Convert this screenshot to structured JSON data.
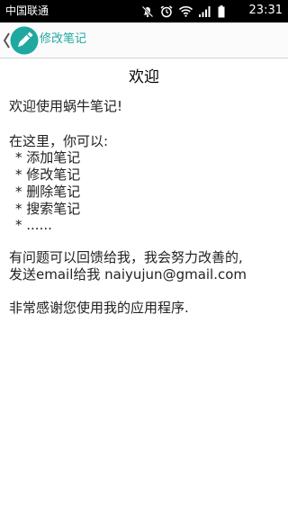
{
  "status_bar": {
    "carrier": "中国联通",
    "time": "23:31"
  },
  "action_bar": {
    "title": "修改笔记",
    "accent_color": "#1fa8a0"
  },
  "note": {
    "title": "欢迎",
    "greeting": "欢迎使用蜗牛笔记!",
    "intro": "在这里，你可以:",
    "features": [
      "* 添加笔记",
      "* 修改笔记",
      "* 删除笔记",
      "* 搜索笔记",
      "* ......"
    ],
    "feedback_line1": "有问题可以回馈给我，我会努力改善的,",
    "feedback_line2": "发送email给我 naiyujun@gmail.com",
    "thanks": "非常感谢您使用我的应用程序."
  }
}
